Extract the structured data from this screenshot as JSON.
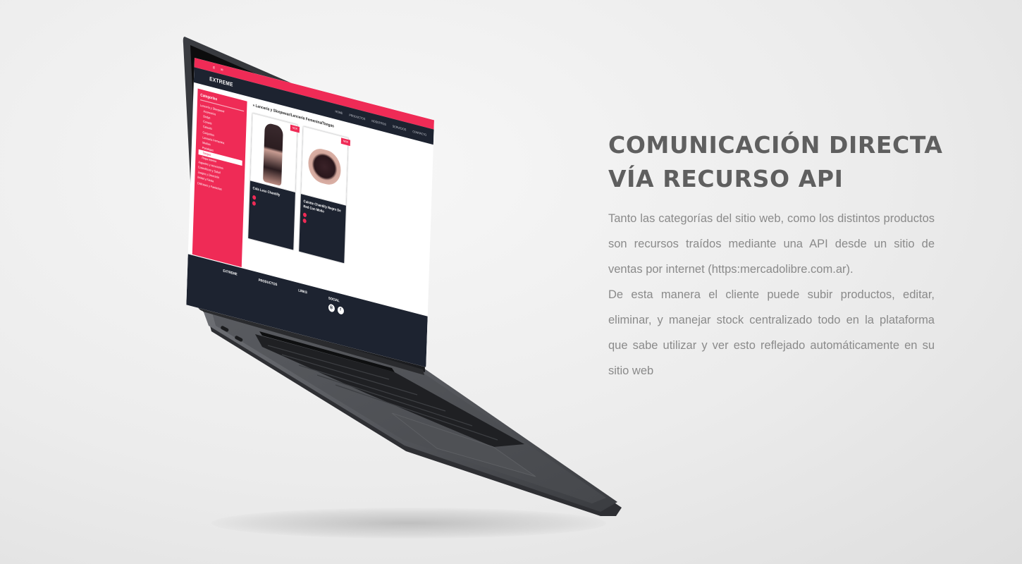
{
  "headline": {
    "line1": "COMUNICACIÓN DIRECTA",
    "line2": "VÍA RECURSO API"
  },
  "description": {
    "paragraph1": "Tanto las categorías del sitio web, como los distintos productos son recursos traídos mediante una API desde un sitio de ventas por internet (https:mercadolibre.com.ar).",
    "paragraph2": "De esta manera el cliente puede subir productos, editar, eliminar, y manejar stock centralizado todo en la plataforma que sabe utilizar y ver esto reflejado automáticamente en su sitio web"
  },
  "mockup": {
    "logo": "EXTREME",
    "nav": [
      "HOME",
      "PRODUCTOS",
      "NOSOTROS",
      "SERVICIOS",
      "CONTACTO"
    ],
    "sidebar_title": "Categorías",
    "sidebar_items": [
      "Lencería y Sleepwear",
      "Accesorios",
      "Bodys",
      "Corsets",
      "Catsuits",
      "Conjuntos",
      "Lencería Femenina",
      "Medias",
      "Portaligas",
      "Tangas",
      "Ropa Interior",
      "Juguetes y accesorios",
      "Cosméticos y Salud",
      "Juegos y Diversión",
      "Bridal y Fiesta",
      "Disfraces y Fantasías"
    ],
    "sidebar_active_index": 9,
    "breadcrumb": "» Lencería y Sleepwear/Lencería Femenina/Tangas",
    "products": [
      {
        "name": "Cola Less Chantilly",
        "badge": "NEW"
      },
      {
        "name": "Culotte Chantilly Negro De Red Con Moño",
        "badge": "NEW"
      }
    ],
    "footer": {
      "brand": "EXTREME",
      "productos_title": "PRODUCTOS",
      "links_title": "LINKS",
      "social_title": "SOCIAL"
    }
  },
  "colors": {
    "accent": "#ef2b56",
    "dark": "#1d2330",
    "headline": "#5f5f5f",
    "body_text": "#8a8a8a"
  }
}
